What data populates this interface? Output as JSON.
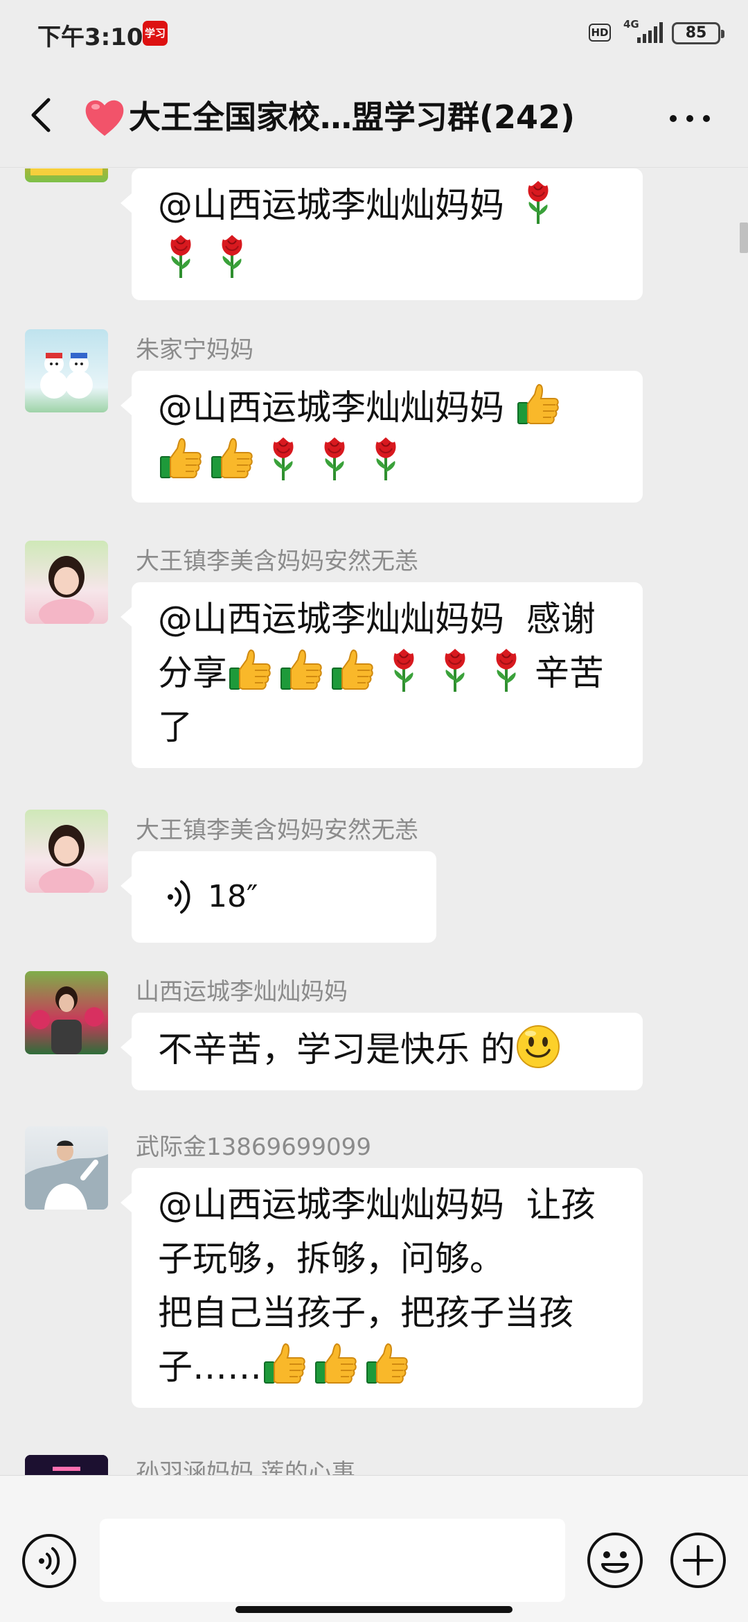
{
  "status_bar": {
    "time": "下午3:10",
    "app_badge": "学习",
    "hd_label": "HD",
    "network_label": "4G",
    "battery_level": "85"
  },
  "header": {
    "title": "大王全国家校…盟学习群(242)",
    "title_prefix_icon": "heart-icon",
    "back_icon": "back-chevron-icon",
    "more_icon": "more-dots-icon"
  },
  "messages": [
    {
      "sender": "",
      "type": "text",
      "text": "@山西运城李灿灿妈妈 ",
      "emojis": [
        "rose",
        "rose",
        "rose"
      ]
    },
    {
      "sender": "朱家宁妈妈",
      "type": "text",
      "text": "@山西运城李灿灿妈妈 ",
      "emojis": [
        "thumbs-up",
        "thumbs-up",
        "thumbs-up",
        "rose",
        "rose",
        "rose"
      ]
    },
    {
      "sender": "大王镇李美含妈妈安然无恙",
      "type": "text",
      "text": "@山西运城李灿灿妈妈  感谢分享",
      "emojis": [
        "thumbs-up",
        "thumbs-up",
        "thumbs-up",
        "rose",
        "rose",
        "rose"
      ],
      "text_after": "辛苦了"
    },
    {
      "sender": "大王镇李美含妈妈安然无恙",
      "type": "voice",
      "duration": "18″"
    },
    {
      "sender": "山西运城李灿灿妈妈",
      "type": "text",
      "text": "不辛苦，学习是快乐 的",
      "emojis": [
        "smile"
      ]
    },
    {
      "sender": "武际金13869699099",
      "type": "text",
      "text": "@山西运城李灿灿妈妈  让孩子玩够，拆够，问够。\n把自己当孩子，把孩子当孩子……",
      "emojis": [
        "thumbs-up",
        "thumbs-up",
        "thumbs-up"
      ]
    },
    {
      "sender": "孙羽涵妈妈  莲的心事",
      "type": "partial"
    }
  ],
  "input_bar": {
    "voice_icon": "voice-input-icon",
    "emoji_icon": "emoji-icon",
    "plus_icon": "plus-icon",
    "placeholder": ""
  },
  "colors": {
    "background": "#ededed",
    "bubble": "#ffffff",
    "sender_text": "#8b8b8b",
    "rose_red": "#e0202a",
    "thumb_yellow": "#f7b52c"
  }
}
